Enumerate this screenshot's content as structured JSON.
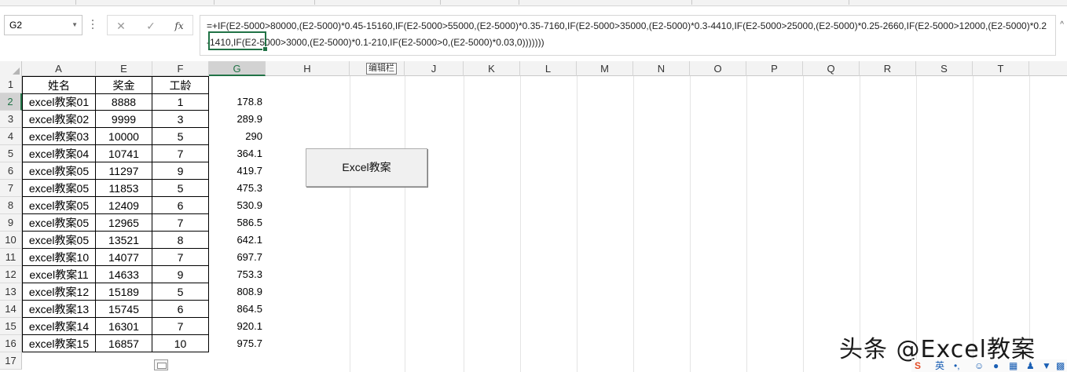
{
  "formula_bar": {
    "name_box": "G2",
    "cancel_glyph": "✕",
    "confirm_glyph": "✓",
    "fx_label": "fx",
    "formula": "=+IF(E2-5000>80000,(E2-5000)*0.45-15160,IF(E2-5000>55000,(E2-5000)*0.35-7160,IF(E2-5000>35000,(E2-5000)*0.3-4410,IF(E2-5000>25000,(E2-5000)*0.25-2660,IF(E2-5000>12000,(E2-5000)*0.2-1410,IF(E2-5000>3000,(E2-5000)*0.1-210,IF(E2-5000>0,(E2-5000)*0.03,0)))))))"
  },
  "columns": [
    "A",
    "E",
    "F",
    "G",
    "H",
    "J",
    "K",
    "L",
    "M",
    "N",
    "O",
    "P",
    "Q",
    "R",
    "S",
    "T"
  ],
  "tooltip": "编辑栏",
  "headers": {
    "name": "姓名",
    "bonus": "奖金",
    "years": "工龄"
  },
  "rows": [
    {
      "num": "2",
      "name": "excel教案01",
      "bonus": "8888",
      "years": "1",
      "tax": "178.8"
    },
    {
      "num": "3",
      "name": "excel教案02",
      "bonus": "9999",
      "years": "3",
      "tax": "289.9"
    },
    {
      "num": "4",
      "name": "excel教案03",
      "bonus": "10000",
      "years": "5",
      "tax": "290"
    },
    {
      "num": "5",
      "name": "excel教案04",
      "bonus": "10741",
      "years": "7",
      "tax": "364.1"
    },
    {
      "num": "6",
      "name": "excel教案05",
      "bonus": "11297",
      "years": "9",
      "tax": "419.7"
    },
    {
      "num": "7",
      "name": "excel教案05",
      "bonus": "11853",
      "years": "5",
      "tax": "475.3"
    },
    {
      "num": "8",
      "name": "excel教案05",
      "bonus": "12409",
      "years": "6",
      "tax": "530.9"
    },
    {
      "num": "9",
      "name": "excel教案05",
      "bonus": "12965",
      "years": "7",
      "tax": "586.5"
    },
    {
      "num": "10",
      "name": "excel教案05",
      "bonus": "13521",
      "years": "8",
      "tax": "642.1"
    },
    {
      "num": "11",
      "name": "excel教案10",
      "bonus": "14077",
      "years": "7",
      "tax": "697.7"
    },
    {
      "num": "12",
      "name": "excel教案11",
      "bonus": "14633",
      "years": "9",
      "tax": "753.3"
    },
    {
      "num": "13",
      "name": "excel教案12",
      "bonus": "15189",
      "years": "5",
      "tax": "808.9"
    },
    {
      "num": "14",
      "name": "excel教案13",
      "bonus": "15745",
      "years": "6",
      "tax": "864.5"
    },
    {
      "num": "15",
      "name": "excel教案14",
      "bonus": "16301",
      "years": "7",
      "tax": "920.1"
    },
    {
      "num": "16",
      "name": "excel教案15",
      "bonus": "16857",
      "years": "10",
      "tax": "975.7"
    }
  ],
  "row_nums": [
    "1",
    "17"
  ],
  "button": {
    "label": "Excel教案"
  },
  "watermark": "头条 @Excel教案",
  "tray": {
    "ime": "英"
  },
  "colors": {
    "accent": "#217346",
    "selected_header": "#d2d2d2"
  }
}
